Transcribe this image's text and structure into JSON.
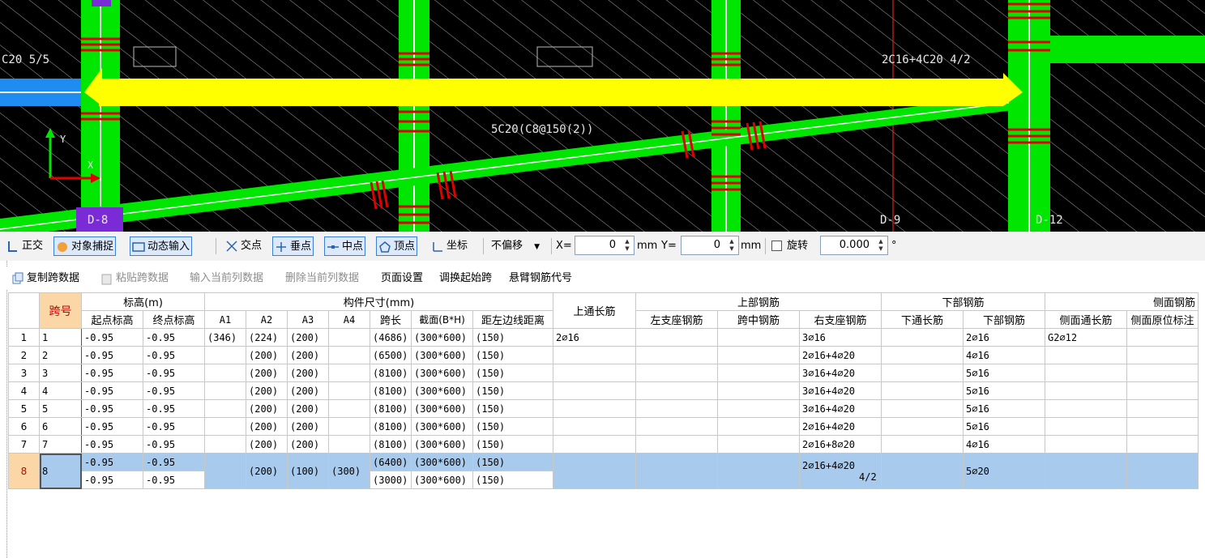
{
  "canvas": {
    "labels": {
      "top_left": "C20 5/5",
      "beam_annotation": "5C20(C8@150(2))",
      "top_right": "2C16+4C20 4/2",
      "axis_d8": "D-8",
      "axis_d9": "D-9",
      "axis_d12": "D-12",
      "ucs_y": "Y",
      "ucs_x": "X"
    }
  },
  "snapbar": {
    "ortho": "正交",
    "snap": "对象捕捉",
    "dyn_input": "动态输入",
    "intersection": "交点",
    "perpendicular": "垂点",
    "midpoint": "中点",
    "vertex": "顶点",
    "coord": "坐标",
    "offset_mode": "不偏移",
    "x_label": "X=",
    "x_value": "0",
    "mm1": "mm",
    "y_label": "Y=",
    "y_value": "0",
    "mm2": "mm",
    "rotate_label": "旋转",
    "rotate_value": "0.000",
    "degree": "°"
  },
  "toolbar": {
    "copy_span": "复制跨数据",
    "paste_span": "粘贴跨数据",
    "input_col": "输入当前列数据",
    "delete_col": "删除当前列数据",
    "page_setup": "页面设置",
    "swap_start": "调换起始跨",
    "cantilever": "悬臂钢筋代号"
  },
  "grid": {
    "headers": {
      "span": "跨号",
      "elevation": "标高(m)",
      "start_elev": "起点标高",
      "end_elev": "终点标高",
      "member_size": "构件尺寸(mm)",
      "a1": "A1",
      "a2": "A2",
      "a3": "A3",
      "a4": "A4",
      "span_len": "跨长",
      "section": "截面(B*H)",
      "dist_left": "距左边线距离",
      "top_through": "上通长筋",
      "top_rebar": "上部钢筋",
      "left_support": "左支座钢筋",
      "mid_span": "跨中钢筋",
      "right_support": "右支座钢筋",
      "bottom_rebar_group": "下部钢筋",
      "bottom_through": "下通长筋",
      "bottom_rebar": "下部钢筋",
      "side_rebar": "侧面钢筋",
      "side_through": "侧面通长筋",
      "side_original": "侧面原位标注"
    },
    "rows": [
      {
        "n": "1",
        "span": "1",
        "start": "-0.95",
        "end": "-0.95",
        "a1": "(346)",
        "a2": "(224)",
        "a3": "(200)",
        "a4": "",
        "len": "(4686)",
        "sec": "(300*600)",
        "dist": "(150)",
        "top_through": "2⌀16",
        "left": "",
        "mid": "",
        "right": "3⌀16",
        "bot_through": "",
        "bottom": "2⌀16",
        "side_through": "G2⌀12",
        "side_orig": ""
      },
      {
        "n": "2",
        "span": "2",
        "start": "-0.95",
        "end": "-0.95",
        "a1": "",
        "a2": "(200)",
        "a3": "(200)",
        "a4": "",
        "len": "(6500)",
        "sec": "(300*600)",
        "dist": "(150)",
        "top_through": "",
        "left": "",
        "mid": "",
        "right": "2⌀16+4⌀20",
        "bot_through": "",
        "bottom": "4⌀16",
        "side_through": "",
        "side_orig": ""
      },
      {
        "n": "3",
        "span": "3",
        "start": "-0.95",
        "end": "-0.95",
        "a1": "",
        "a2": "(200)",
        "a3": "(200)",
        "a4": "",
        "len": "(8100)",
        "sec": "(300*600)",
        "dist": "(150)",
        "top_through": "",
        "left": "",
        "mid": "",
        "right": "3⌀16+4⌀20",
        "bot_through": "",
        "bottom": "5⌀16",
        "side_through": "",
        "side_orig": ""
      },
      {
        "n": "4",
        "span": "4",
        "start": "-0.95",
        "end": "-0.95",
        "a1": "",
        "a2": "(200)",
        "a3": "(200)",
        "a4": "",
        "len": "(8100)",
        "sec": "(300*600)",
        "dist": "(150)",
        "top_through": "",
        "left": "",
        "mid": "",
        "right": "3⌀16+4⌀20",
        "bot_through": "",
        "bottom": "5⌀16",
        "side_through": "",
        "side_orig": ""
      },
      {
        "n": "5",
        "span": "5",
        "start": "-0.95",
        "end": "-0.95",
        "a1": "",
        "a2": "(200)",
        "a3": "(200)",
        "a4": "",
        "len": "(8100)",
        "sec": "(300*600)",
        "dist": "(150)",
        "top_through": "",
        "left": "",
        "mid": "",
        "right": "3⌀16+4⌀20",
        "bot_through": "",
        "bottom": "5⌀16",
        "side_through": "",
        "side_orig": ""
      },
      {
        "n": "6",
        "span": "6",
        "start": "-0.95",
        "end": "-0.95",
        "a1": "",
        "a2": "(200)",
        "a3": "(200)",
        "a4": "",
        "len": "(8100)",
        "sec": "(300*600)",
        "dist": "(150)",
        "top_through": "",
        "left": "",
        "mid": "",
        "right": "2⌀16+4⌀20",
        "bot_through": "",
        "bottom": "5⌀16",
        "side_through": "",
        "side_orig": ""
      },
      {
        "n": "7",
        "span": "7",
        "start": "-0.95",
        "end": "-0.95",
        "a1": "",
        "a2": "(200)",
        "a3": "(200)",
        "a4": "",
        "len": "(8100)",
        "sec": "(300*600)",
        "dist": "(150)",
        "top_through": "",
        "left": "",
        "mid": "",
        "right": "2⌀16+8⌀20",
        "bot_through": "",
        "bottom": "4⌀16",
        "side_through": "",
        "side_orig": ""
      }
    ],
    "row8": {
      "n": "8",
      "span": "8",
      "start1": "-0.95",
      "end1": "-0.95",
      "start2": "-0.95",
      "end2": "-0.95",
      "a2": "(200)",
      "a3": "(100)",
      "a4": "(300)",
      "len1": "(6400)",
      "sec1": "(300*600)",
      "dist1": "(150)",
      "len2": "(3000)",
      "sec2": "(300*600)",
      "dist2": "(150)",
      "right1": "2⌀16+4⌀20",
      "right2": "4/2",
      "bottom": "5⌀20"
    }
  }
}
